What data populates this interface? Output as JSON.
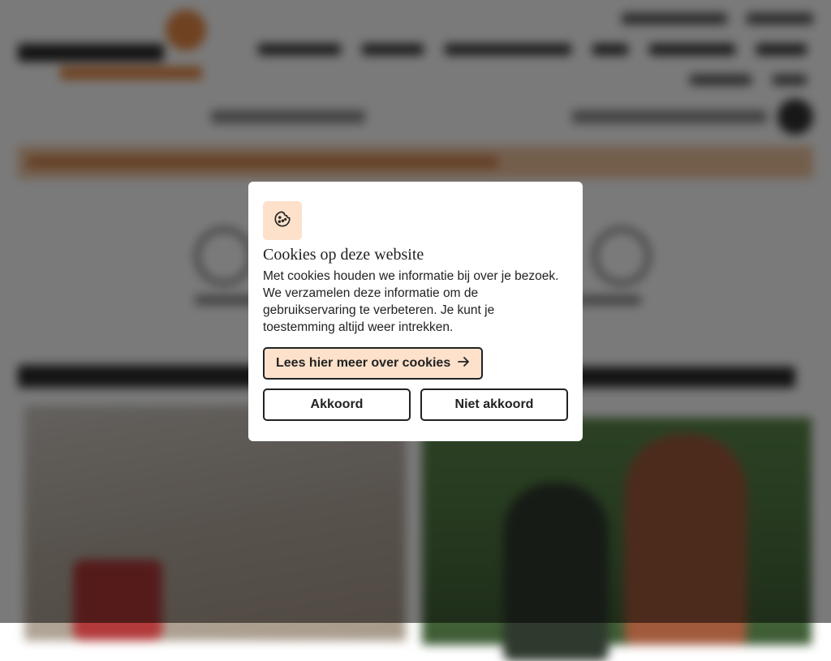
{
  "cookie_dialog": {
    "icon": "cookie-icon",
    "title": "Cookies op deze website",
    "body": "Met cookies houden we informatie bij over je bezoek. We verzamelen deze informatie om de gebruikservaring te verbeteren. Je kunt je toestemming altijd weer intrekken.",
    "more_label": "Lees hier meer over cookies",
    "more_icon": "arrow-right-icon",
    "accept_label": "Akkoord",
    "decline_label": "Niet akkoord"
  },
  "colors": {
    "accent": "#e98a45",
    "badge_background": "#fde1cb",
    "overlay": "rgba(0,0,0,0.52)"
  }
}
